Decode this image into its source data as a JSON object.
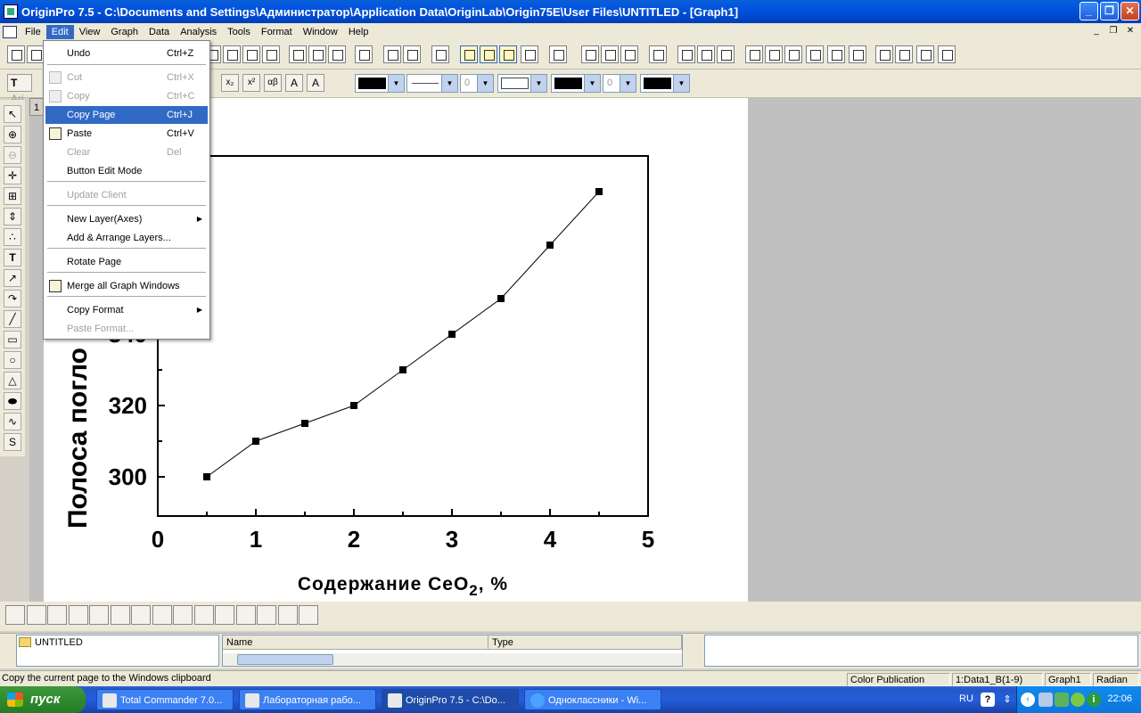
{
  "window": {
    "title": "OriginPro 7.5 - C:\\Documents and Settings\\Администратор\\Application Data\\OriginLab\\Origin75E\\User Files\\UNTITLED - [Graph1]",
    "min": "_",
    "max": "❐",
    "close": "✕"
  },
  "menubar": {
    "items": [
      "File",
      "Edit",
      "View",
      "Graph",
      "Data",
      "Analysis",
      "Tools",
      "Format",
      "Window",
      "Help"
    ],
    "active": "Edit"
  },
  "toolbar2": {
    "font_combo": "Ari",
    "linewidth_combo": "0",
    "pattern_combo": "0"
  },
  "edit_menu": {
    "items": [
      {
        "label": "Undo",
        "shortcut": "Ctrl+Z",
        "disabled": false
      },
      {
        "label": "Cut",
        "shortcut": "Ctrl+X",
        "disabled": true
      },
      {
        "label": "Copy",
        "shortcut": "Ctrl+C",
        "disabled": true
      },
      {
        "label": "Copy Page",
        "shortcut": "Ctrl+J",
        "disabled": false,
        "highlight": true
      },
      {
        "label": "Paste",
        "shortcut": "Ctrl+V",
        "disabled": false
      },
      {
        "label": "Clear",
        "shortcut": "Del",
        "disabled": true
      },
      {
        "label": "Button Edit Mode",
        "shortcut": "",
        "disabled": false
      },
      {
        "label": "Update Client",
        "shortcut": "",
        "disabled": true
      },
      {
        "label": "New Layer(Axes)",
        "shortcut": "",
        "disabled": false,
        "submenu": true
      },
      {
        "label": "Add & Arrange Layers...",
        "shortcut": "",
        "disabled": false
      },
      {
        "label": "Rotate Page",
        "shortcut": "",
        "disabled": false
      },
      {
        "label": "Merge all Graph Windows",
        "shortcut": "",
        "disabled": false
      },
      {
        "label": "Copy Format",
        "shortcut": "",
        "disabled": false,
        "submenu": true
      },
      {
        "label": "Paste Format...",
        "shortcut": "",
        "disabled": true
      }
    ]
  },
  "layer_tab": "1",
  "chart_data": {
    "type": "line",
    "x": [
      0.5,
      1.0,
      1.5,
      2.0,
      2.5,
      3.0,
      3.5,
      4.0,
      4.5
    ],
    "y": [
      300,
      310,
      315,
      320,
      330,
      340,
      350,
      365,
      380
    ],
    "xlim": [
      0,
      5
    ],
    "ylim": [
      289,
      390
    ],
    "x_ticks": [
      "0",
      "1",
      "2",
      "3",
      "4",
      "5"
    ],
    "y_ticks": [
      "300",
      "320",
      "340"
    ],
    "xlabel_main": "Содержание CeO",
    "xlabel_sub": "2",
    "xlabel_tail": ", %",
    "ylabel": "Полоса погло",
    "marker": "square",
    "color": "#000000"
  },
  "project": {
    "folder": "UNTITLED",
    "col_name": "Name",
    "col_type": "Type"
  },
  "statusbar": {
    "message": "Copy the current page to the Windows clipboard",
    "mode": "Color Publication",
    "dataset": "1:Data1_B(1-9)",
    "window": "Graph1",
    "angle": "Radian"
  },
  "taskbar": {
    "start": "пуск",
    "tasks": [
      "Total Commander 7.0...",
      "Лабораторная рабо...",
      "OriginPro 7.5 - C:\\Do...",
      "Одноклассники - Wi..."
    ],
    "lang": "RU",
    "clock": "22:06"
  }
}
